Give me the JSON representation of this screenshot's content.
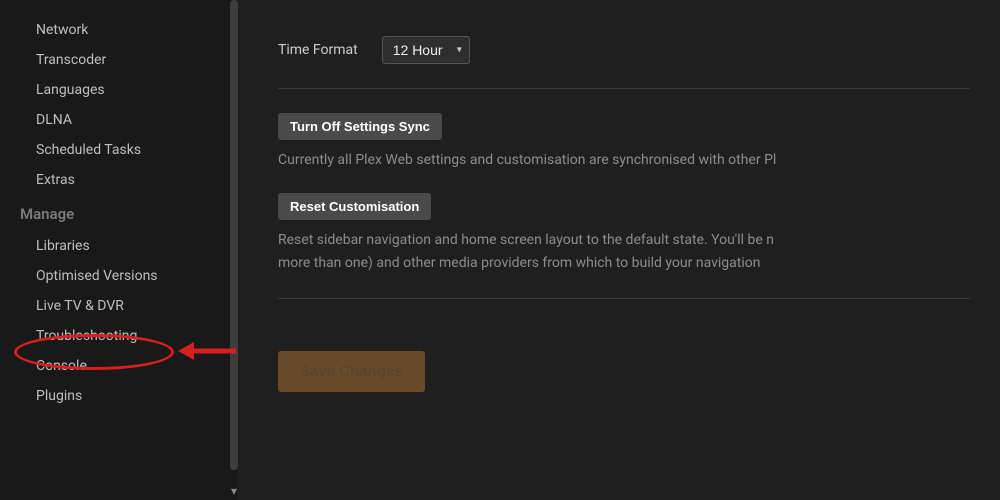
{
  "sidebar": {
    "itemsTop": [
      "Network",
      "Transcoder",
      "Languages",
      "DLNA",
      "Scheduled Tasks",
      "Extras"
    ],
    "sectionHeader": "Manage",
    "itemsManage": [
      "Libraries",
      "Optimised Versions",
      "Live TV & DVR",
      "Troubleshooting",
      "Console",
      "Plugins"
    ]
  },
  "main": {
    "timeFormat": {
      "label": "Time Format",
      "selected": "12 Hour"
    },
    "syncButton": "Turn Off Settings Sync",
    "syncHelp": "Currently all Plex Web settings and customisation are synchronised with other Pl",
    "resetButton": "Reset Customisation",
    "resetHelp1": "Reset sidebar navigation and home screen layout to the default state. You'll be n",
    "resetHelp2": "more than one) and other media providers from which to build your navigation",
    "saveButton": "Save Changes"
  }
}
